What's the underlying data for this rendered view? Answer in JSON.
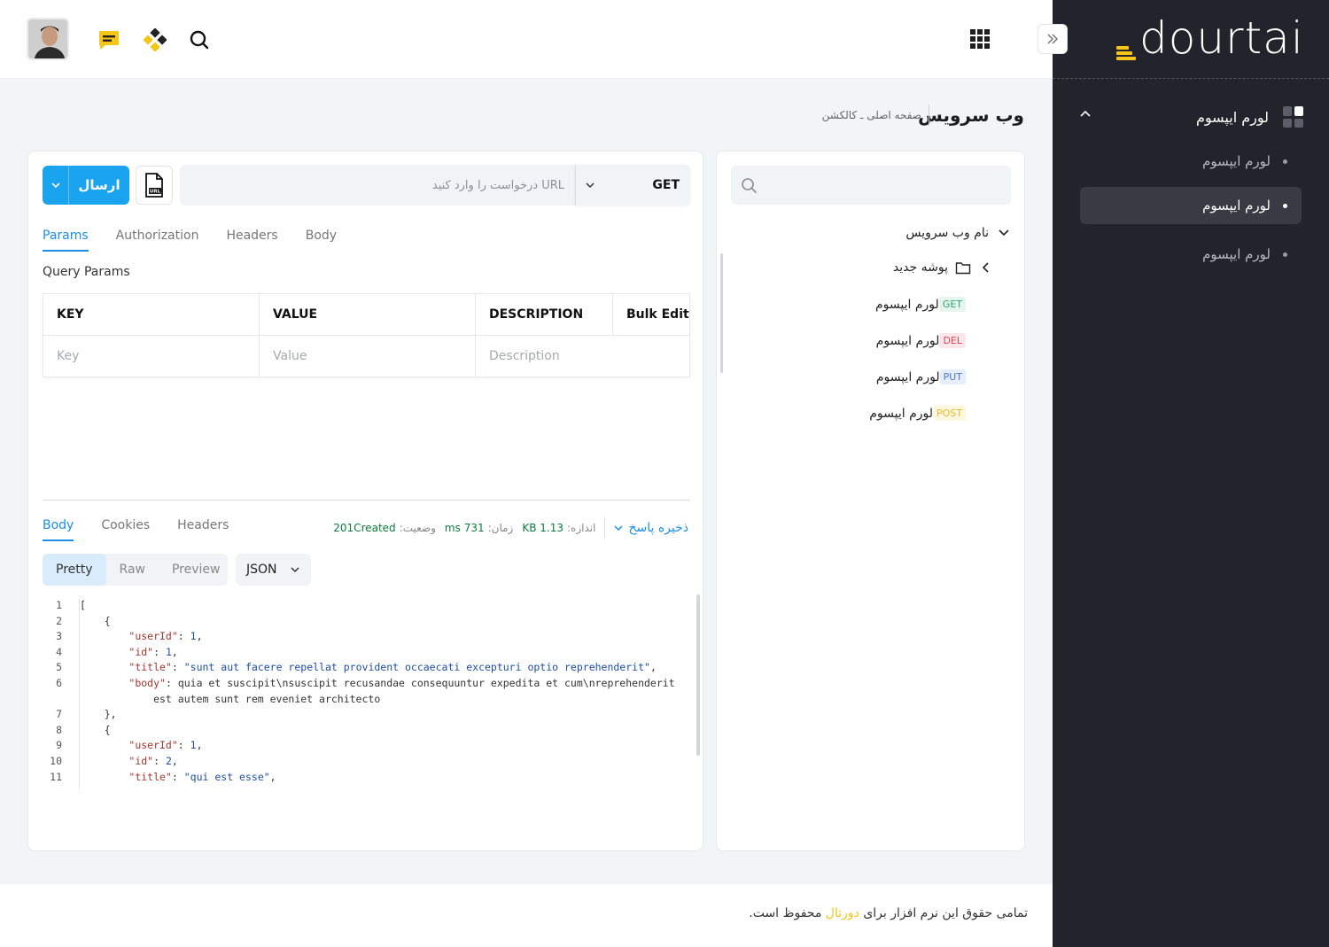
{
  "header": {
    "avatar_alt": "",
    "icons": [
      "chat-icon",
      "diamond-icon",
      "search-icon",
      "apps-icon"
    ]
  },
  "sidebar": {
    "logo_text": "dourtai",
    "group_label": "لورم ایپسوم",
    "items": [
      {
        "label": "لورم ایپسوم",
        "active": false
      },
      {
        "label": "لورم ایپسوم",
        "active": true
      },
      {
        "label": "لورم ایپسوم",
        "active": false
      }
    ],
    "accent_color": "#f5c518"
  },
  "breadcrumb": {
    "title": "وب سرویس",
    "path": "صفحه اصلی ـ کالکشن"
  },
  "request": {
    "send_label": "ارسال",
    "url_placeholder": "URL درخواست را وارد کنید",
    "method": "GET",
    "tabs": [
      "Params",
      "Authorization",
      "Headers",
      "Body"
    ],
    "active_tab": "Params",
    "section_label": "Query Params",
    "table": {
      "headers": [
        "KEY",
        "VALUE",
        "DESCRIPTION",
        "Bulk Edit"
      ],
      "placeholders": [
        "Key",
        "Value",
        "Description"
      ]
    }
  },
  "response": {
    "tabs": [
      "Body",
      "Cookies",
      "Headers"
    ],
    "active_tab": "Body",
    "save_label": "ذخیره پاسخ",
    "size_key": "اندازه:",
    "size_value": "1.13 KB",
    "time_key": "زمان:",
    "time_value": "731 ms",
    "status_key": "وضعیت:",
    "status_value": "201Created",
    "views": [
      "Pretty",
      "Raw",
      "Preview"
    ],
    "active_view": "Pretty",
    "format": "JSON",
    "code_lines": [
      {
        "n": "1",
        "text": "["
      },
      {
        "n": "2",
        "text": "    {"
      },
      {
        "n": "3",
        "text": "        \"userId\": 1,"
      },
      {
        "n": "4",
        "text": "        \"id\": 1,"
      },
      {
        "n": "5",
        "text": "        \"title\": \"sunt aut facere repellat provident occaecati excepturi optio reprehenderit\","
      },
      {
        "n": "6",
        "text": "        \"body\": \"quia et suscipit\\nsuscipit recusandae consequuntur expedita et cum\\nreprehenderit"
      },
      {
        "n": "",
        "text": "            est autem sunt rem eveniet architecto\""
      },
      {
        "n": "7",
        "text": "    },"
      },
      {
        "n": "8",
        "text": "    {"
      },
      {
        "n": "9",
        "text": "        \"userId\": 1,"
      },
      {
        "n": "10",
        "text": "        \"id\": 2,"
      },
      {
        "n": "11",
        "text": "        \"title\": \"qui est esse\","
      }
    ]
  },
  "collection": {
    "search_placeholder": "",
    "service_name": "نام وب سرویس",
    "folder_name": "پوشه جدید",
    "requests": [
      {
        "method": "GET",
        "label": "لورم ایپسوم"
      },
      {
        "method": "DEL",
        "label": "لورم ایپسوم"
      },
      {
        "method": "PUT",
        "label": "لورم ایپسوم"
      },
      {
        "method": "POST",
        "label": "لورم ایپسوم"
      }
    ]
  },
  "footer": {
    "text_before": "تمامی حقوق این نرم افزار برای",
    "brand": "دورتال",
    "text_after": "محفوظ است."
  }
}
